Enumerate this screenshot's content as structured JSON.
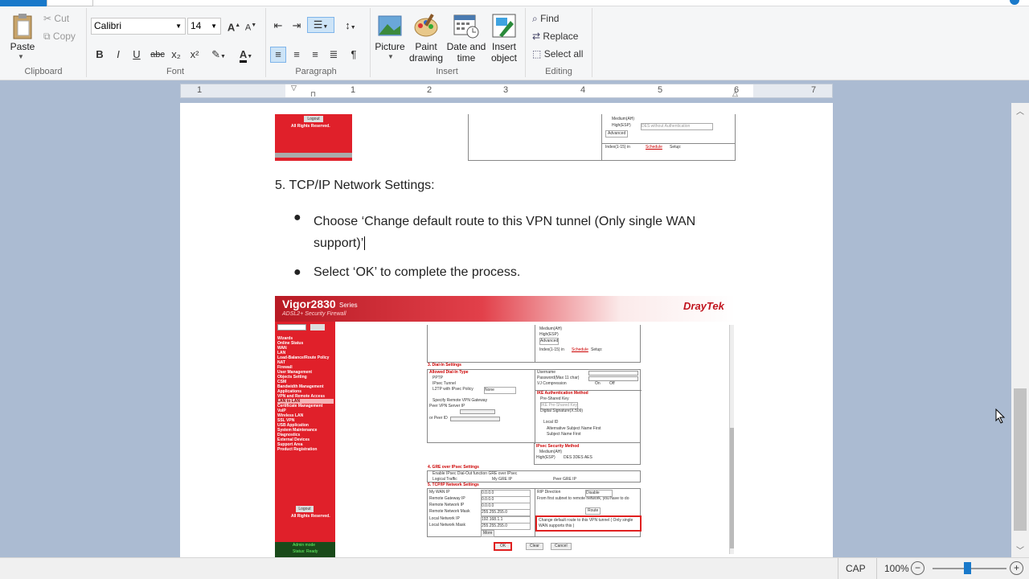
{
  "ribbon": {
    "clipboard": {
      "paste": "Paste",
      "cut": "Cut",
      "copy": "Copy",
      "label": "Clipboard"
    },
    "font": {
      "family": "Calibri",
      "size": "14",
      "label": "Font",
      "bold": "B",
      "italic": "I",
      "underline": "U",
      "strike": "abc",
      "sub": "x₂",
      "sup": "x²"
    },
    "paragraph": {
      "label": "Paragraph"
    },
    "insert": {
      "picture": "Picture",
      "paint_1": "Paint",
      "paint_2": "drawing",
      "datetime_1": "Date and",
      "datetime_2": "time",
      "object_1": "Insert",
      "object_2": "object",
      "label": "Insert"
    },
    "editing": {
      "find": "Find",
      "replace": "Replace",
      "select_all": "Select all",
      "label": "Editing"
    }
  },
  "ruler": {
    "numbers": [
      "1",
      "1",
      "2",
      "3",
      "4",
      "5",
      "6",
      "7"
    ]
  },
  "doc": {
    "top_logout": "Logout",
    "top_rights": "All Rights Reserved.",
    "top_medium": "Medium(AH)",
    "top_high": "High(ESP)",
    "top_des": "DES without Authentication",
    "top_adv": "Advanced",
    "top_index": "Index(1-15) in",
    "top_schedule": "Schedule",
    "top_setup": "Setup:",
    "heading": "5. TCP/IP Network Settings:",
    "bullet1_line1": "Choose ‘Change default route to this VPN tunnel (Only single WAN",
    "bullet1_line2": "support)’",
    "bullet2": "Select ‘OK’ to complete the process."
  },
  "screenshot": {
    "model": "Vigor2830",
    "series": "Series",
    "subtitle": "ADSL2+ Security Firewall",
    "brand": "DrayTek",
    "menu": [
      "Wizards",
      "Online Status",
      "",
      "WAN",
      "LAN",
      "Load-Balance/Route Policy",
      "NAT",
      "Firewall",
      "User Management",
      "Objects Setting",
      "CSM",
      "Bandwidth Management",
      "Applications",
      "VPN and Remote Access",
      "",
      "",
      "",
      "",
      "",
      "LAN to LAN",
      "",
      "Certificate Management",
      "VoIP",
      "Wireless LAN",
      "SSL VPN",
      "USB Application",
      "System Maintenance",
      "Diagnostics",
      "External Devices",
      "",
      "Support Area",
      "Product Registration"
    ],
    "logout": "Logout",
    "rights": "All Rights Reserved.",
    "admin": "Admin mode",
    "status": "Status: Ready",
    "s_dialin": "3. Dial-In Settings",
    "s_allowed": "Allowed Dial-In Type",
    "s_pptp": "PPTP",
    "s_ipsec": "IPsec Tunnel",
    "s_l2tp": "L2TP with IPsec Policy",
    "s_none": "None",
    "s_specify": "Specify Remote VPN Gateway",
    "s_peer": "Peer VPN Server IP",
    "s_peerid": "or Peer ID",
    "s_username": "Username",
    "s_password": "Password(Max 11 char)",
    "s_vj": "VJ Compression",
    "s_on": "On",
    "s_off": "Off",
    "s_ike": "IKE Authentication Method",
    "s_psk": "Pre-Shared Key",
    "s_ikepsk": "IKE Pre-Shared Key",
    "s_digsig": "Digital Signature(X.509)",
    "s_localid": "Local ID",
    "s_alt": "Alternative Subject Name First",
    "s_subj": "Subject Name First",
    "s_secmethod": "IPsec Security Method",
    "s_medium": "Medium(AH)",
    "s_high": "High(ESP)",
    "s_algos": "DES   3DES   AES",
    "s_gre": "4. GRE over IPsec Settings",
    "s_enable_gre": "Enable IPsec Dial-Out function GRE over IPsec",
    "s_logical": "Logical Traffic",
    "s_mygre": "My GRE IP",
    "s_peergre": "Peer GRE IP",
    "s_tcpip": "5. TCP/IP Network Settings",
    "s_mywan": "My WAN IP",
    "s_rgw": "Remote Gateway IP",
    "s_rnet": "Remote Network IP",
    "s_rmask": "Remote Network Mask",
    "s_lnet": "Local Network IP",
    "s_lmask": "Local Network Mask",
    "s_v0": "0.0.0.0",
    "s_vmask": "255.255.255.0",
    "s_vlocal": "192.168.1.1",
    "s_more": "More",
    "s_rip": "RIP Direction",
    "s_disable": "Disable",
    "s_route_text": "From first subnet to remote network, you have to do",
    "s_route": "Route",
    "s_change": "Change default route to this VPN tunnel ( Only single WAN supports this )",
    "s_ok": "OK",
    "s_clear": "Clear",
    "s_cancel": "Cancel"
  },
  "status": {
    "caps": "CAP",
    "zoom": "100%"
  }
}
